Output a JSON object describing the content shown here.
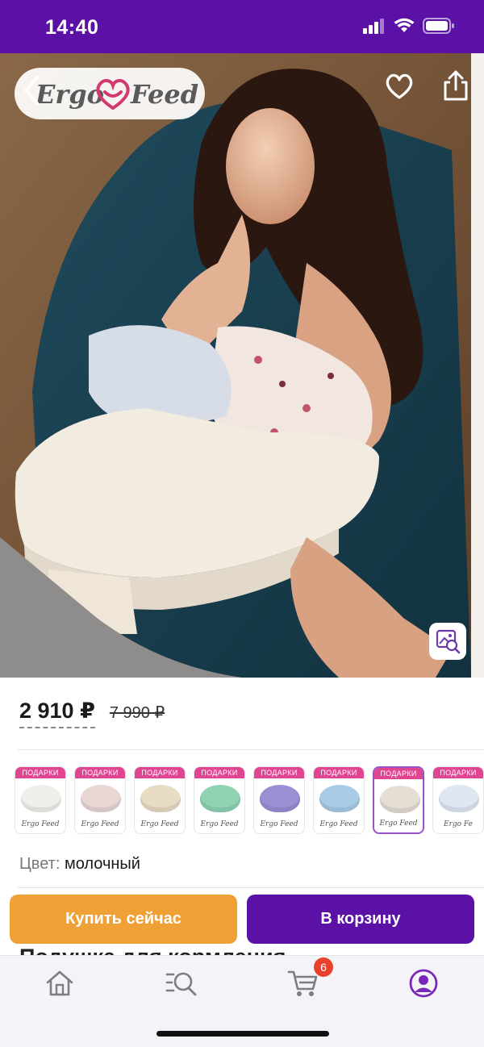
{
  "status_bar": {
    "time": "14:40"
  },
  "product_photo": {
    "brand_left": "Ergo",
    "brand_right": "Feed"
  },
  "price": {
    "current": "2 910 ₽",
    "old": "7 990 ₽"
  },
  "variants": [
    {
      "badge": "ПОДАРКИ",
      "brand": "Ergo Feed",
      "color": "#f1efe9"
    },
    {
      "badge": "ПОДАРКИ",
      "brand": "Ergo Feed",
      "color": "#e9d7d6"
    },
    {
      "badge": "ПОДАРКИ",
      "brand": "Ergo Feed",
      "color": "#e9dcc5"
    },
    {
      "badge": "ПОДАРКИ",
      "brand": "Ergo Feed",
      "color": "#8fd3b2"
    },
    {
      "badge": "ПОДАРКИ",
      "brand": "Ergo Feed",
      "color": "#9a8fd3"
    },
    {
      "badge": "ПОДАРКИ",
      "brand": "Ergo Feed",
      "color": "#a8cbe6"
    },
    {
      "badge": "ПОДАРКИ",
      "brand": "Ergo Feed",
      "color": "#e5ded3",
      "selected": true
    },
    {
      "badge": "ПОДАРКИ",
      "brand": "Ergo Fe",
      "color": "#dfe7f3"
    }
  ],
  "color": {
    "label": "Цвет:",
    "value": "молочный"
  },
  "actions": {
    "buy_now": "Купить сейчас",
    "add_to_cart": "В корзину"
  },
  "product": {
    "title": "Подушка для кормления"
  },
  "tab_bar": {
    "cart_badge": "6"
  },
  "colors": {
    "brand_purple": "#5b11a6",
    "buy_orange": "#f0a135",
    "gift_pink": "#e04592",
    "badge_red": "#e8422e"
  }
}
